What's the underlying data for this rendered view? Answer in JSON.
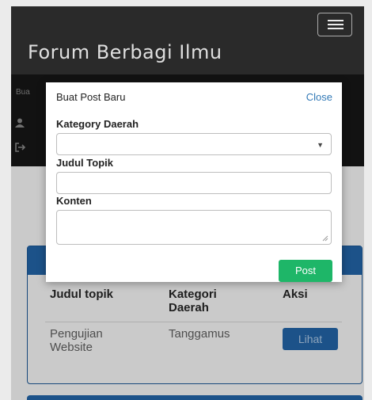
{
  "navbar": {
    "brand": "Forum Berbagi Ilmu",
    "menu_toggle_icon": "hamburger-menu-icon"
  },
  "userbar": {
    "crumb": "Bua",
    "user_icon": "user-icon",
    "logout_icon": "logout-icon"
  },
  "table": {
    "headers": [
      "Judul topik",
      "Kategori Daerah",
      "Aksi"
    ],
    "rows": [
      {
        "judul": "Pengujian Website",
        "kategori": "Tanggamus",
        "aksi": "Lihat"
      }
    ]
  },
  "modal": {
    "title": "Buat Post Baru",
    "close_label": "Close",
    "kategory_label": "Kategory Daerah",
    "kategory_value": "",
    "judul_label": "Judul Topik",
    "judul_value": "",
    "konten_label": "Konten",
    "konten_value": "",
    "post_label": "Post"
  },
  "colors": {
    "navbar": "#2e2e2e",
    "primary": "#1f5a95",
    "success": "#1eb668",
    "link": "#337ab7"
  }
}
